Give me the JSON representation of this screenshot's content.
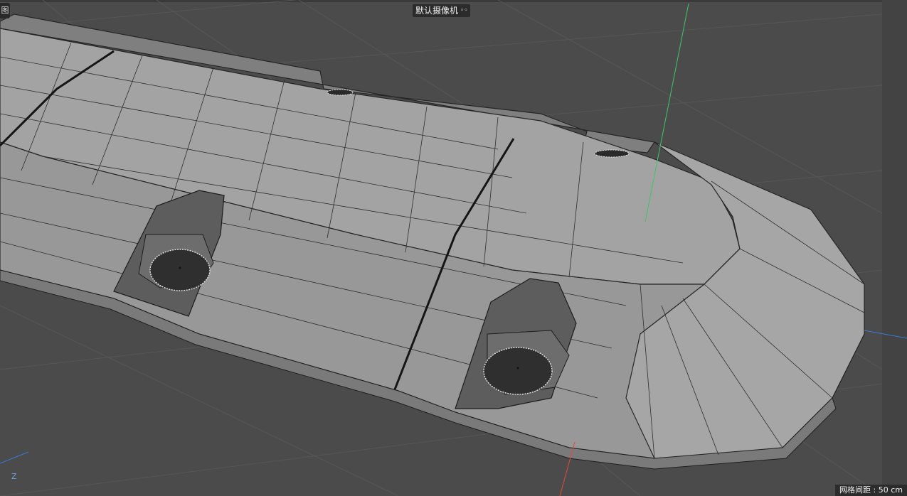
{
  "viewport": {
    "camera_label": "默认摄像机",
    "camera_icon": "camera-icon",
    "corner_tab_label": "图",
    "grid_spacing_label": "网格间距 : 50 cm",
    "axis_z_label": "Z"
  },
  "colors": {
    "background": "#4b4b4b",
    "grid_line": "#5a5a5a",
    "model_fill": "#9a9a9a",
    "model_dark": "#6e6e6e",
    "wire": "#2e2e2e",
    "axis_y": "#3ec46d",
    "axis_x": "#e04a3a",
    "axis_z": "#3a7bd5"
  }
}
